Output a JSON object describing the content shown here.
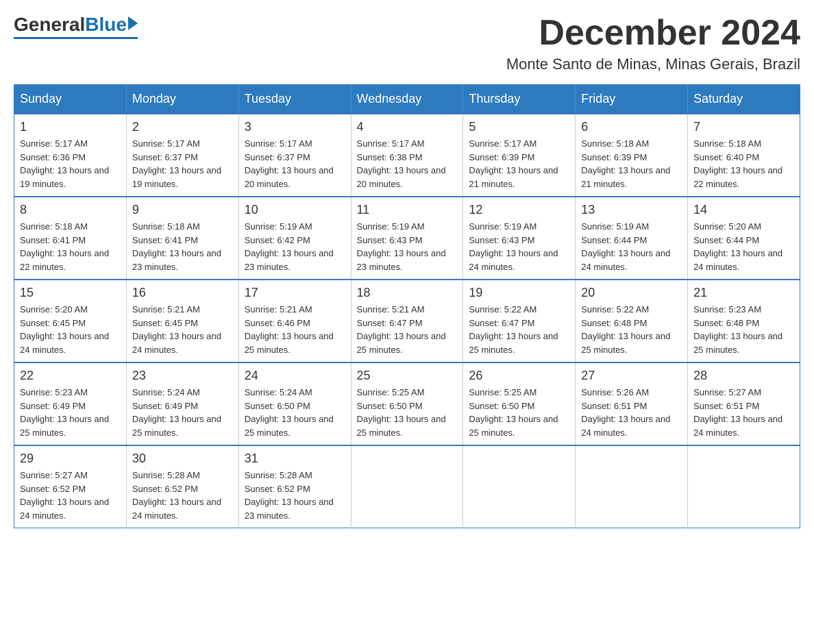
{
  "logo": {
    "general": "General",
    "blue": "Blue"
  },
  "title": "December 2024",
  "location": "Monte Santo de Minas, Minas Gerais, Brazil",
  "weekdays": [
    "Sunday",
    "Monday",
    "Tuesday",
    "Wednesday",
    "Thursday",
    "Friday",
    "Saturday"
  ],
  "weeks": [
    [
      {
        "day": "1",
        "sunrise": "5:17 AM",
        "sunset": "6:36 PM",
        "daylight": "13 hours and 19 minutes."
      },
      {
        "day": "2",
        "sunrise": "5:17 AM",
        "sunset": "6:37 PM",
        "daylight": "13 hours and 19 minutes."
      },
      {
        "day": "3",
        "sunrise": "5:17 AM",
        "sunset": "6:37 PM",
        "daylight": "13 hours and 20 minutes."
      },
      {
        "day": "4",
        "sunrise": "5:17 AM",
        "sunset": "6:38 PM",
        "daylight": "13 hours and 20 minutes."
      },
      {
        "day": "5",
        "sunrise": "5:17 AM",
        "sunset": "6:39 PM",
        "daylight": "13 hours and 21 minutes."
      },
      {
        "day": "6",
        "sunrise": "5:18 AM",
        "sunset": "6:39 PM",
        "daylight": "13 hours and 21 minutes."
      },
      {
        "day": "7",
        "sunrise": "5:18 AM",
        "sunset": "6:40 PM",
        "daylight": "13 hours and 22 minutes."
      }
    ],
    [
      {
        "day": "8",
        "sunrise": "5:18 AM",
        "sunset": "6:41 PM",
        "daylight": "13 hours and 22 minutes."
      },
      {
        "day": "9",
        "sunrise": "5:18 AM",
        "sunset": "6:41 PM",
        "daylight": "13 hours and 23 minutes."
      },
      {
        "day": "10",
        "sunrise": "5:19 AM",
        "sunset": "6:42 PM",
        "daylight": "13 hours and 23 minutes."
      },
      {
        "day": "11",
        "sunrise": "5:19 AM",
        "sunset": "6:43 PM",
        "daylight": "13 hours and 23 minutes."
      },
      {
        "day": "12",
        "sunrise": "5:19 AM",
        "sunset": "6:43 PM",
        "daylight": "13 hours and 24 minutes."
      },
      {
        "day": "13",
        "sunrise": "5:19 AM",
        "sunset": "6:44 PM",
        "daylight": "13 hours and 24 minutes."
      },
      {
        "day": "14",
        "sunrise": "5:20 AM",
        "sunset": "6:44 PM",
        "daylight": "13 hours and 24 minutes."
      }
    ],
    [
      {
        "day": "15",
        "sunrise": "5:20 AM",
        "sunset": "6:45 PM",
        "daylight": "13 hours and 24 minutes."
      },
      {
        "day": "16",
        "sunrise": "5:21 AM",
        "sunset": "6:45 PM",
        "daylight": "13 hours and 24 minutes."
      },
      {
        "day": "17",
        "sunrise": "5:21 AM",
        "sunset": "6:46 PM",
        "daylight": "13 hours and 25 minutes."
      },
      {
        "day": "18",
        "sunrise": "5:21 AM",
        "sunset": "6:47 PM",
        "daylight": "13 hours and 25 minutes."
      },
      {
        "day": "19",
        "sunrise": "5:22 AM",
        "sunset": "6:47 PM",
        "daylight": "13 hours and 25 minutes."
      },
      {
        "day": "20",
        "sunrise": "5:22 AM",
        "sunset": "6:48 PM",
        "daylight": "13 hours and 25 minutes."
      },
      {
        "day": "21",
        "sunrise": "5:23 AM",
        "sunset": "6:48 PM",
        "daylight": "13 hours and 25 minutes."
      }
    ],
    [
      {
        "day": "22",
        "sunrise": "5:23 AM",
        "sunset": "6:49 PM",
        "daylight": "13 hours and 25 minutes."
      },
      {
        "day": "23",
        "sunrise": "5:24 AM",
        "sunset": "6:49 PM",
        "daylight": "13 hours and 25 minutes."
      },
      {
        "day": "24",
        "sunrise": "5:24 AM",
        "sunset": "6:50 PM",
        "daylight": "13 hours and 25 minutes."
      },
      {
        "day": "25",
        "sunrise": "5:25 AM",
        "sunset": "6:50 PM",
        "daylight": "13 hours and 25 minutes."
      },
      {
        "day": "26",
        "sunrise": "5:25 AM",
        "sunset": "6:50 PM",
        "daylight": "13 hours and 25 minutes."
      },
      {
        "day": "27",
        "sunrise": "5:26 AM",
        "sunset": "6:51 PM",
        "daylight": "13 hours and 24 minutes."
      },
      {
        "day": "28",
        "sunrise": "5:27 AM",
        "sunset": "6:51 PM",
        "daylight": "13 hours and 24 minutes."
      }
    ],
    [
      {
        "day": "29",
        "sunrise": "5:27 AM",
        "sunset": "6:52 PM",
        "daylight": "13 hours and 24 minutes."
      },
      {
        "day": "30",
        "sunrise": "5:28 AM",
        "sunset": "6:52 PM",
        "daylight": "13 hours and 24 minutes."
      },
      {
        "day": "31",
        "sunrise": "5:28 AM",
        "sunset": "6:52 PM",
        "daylight": "13 hours and 23 minutes."
      },
      null,
      null,
      null,
      null
    ]
  ]
}
